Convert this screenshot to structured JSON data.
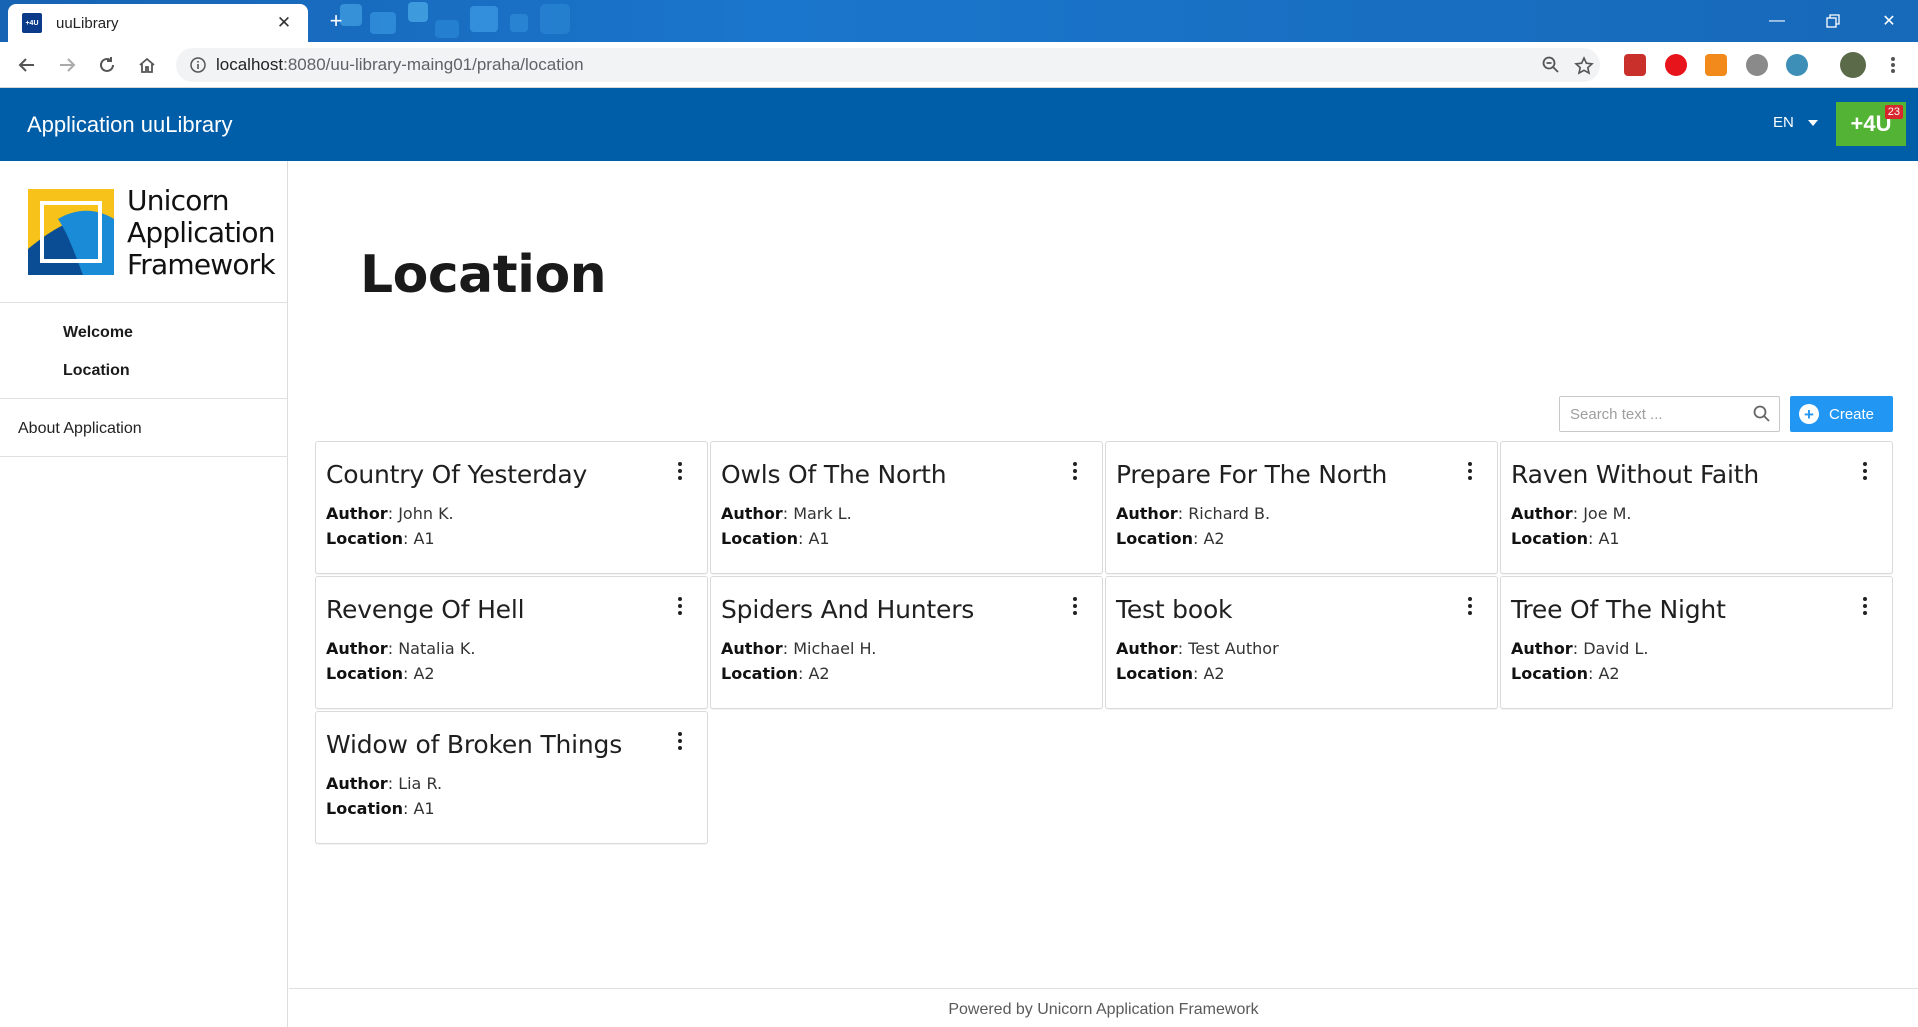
{
  "browser": {
    "tab_title": "uuLibrary",
    "tab_favicon_text": "+4U",
    "url_host": "localhost",
    "url_rest": ":8080/uu-library-maing01/praha/location"
  },
  "header": {
    "app_title": "Application uuLibrary",
    "language": "EN",
    "plus4u_label": "+4U",
    "notification_count": "23"
  },
  "sidebar": {
    "logo_lines": [
      "Unicorn",
      "Application",
      "Framework"
    ],
    "items": [
      {
        "label": "Welcome"
      },
      {
        "label": "Location"
      }
    ],
    "about": "About Application"
  },
  "main": {
    "title": "Location",
    "search_placeholder": "Search text ...",
    "create_label": "Create",
    "author_label": "Author",
    "location_label": "Location",
    "books": [
      {
        "title": "Country Of Yesterday",
        "author": "John K.",
        "location": "A1"
      },
      {
        "title": "Owls Of The North",
        "author": "Mark L.",
        "location": "A1"
      },
      {
        "title": "Prepare For The North",
        "author": "Richard B.",
        "location": "A2"
      },
      {
        "title": "Raven Without Faith",
        "author": "Joe M.",
        "location": "A1"
      },
      {
        "title": "Revenge Of Hell",
        "author": "Natalia K.",
        "location": "A2"
      },
      {
        "title": "Spiders And Hunters",
        "author": "Michael H.",
        "location": "A2"
      },
      {
        "title": "Test book",
        "author": "Test Author",
        "location": "A2"
      },
      {
        "title": "Tree Of The Night",
        "author": "David L.",
        "location": "A2"
      },
      {
        "title": "Widow of Broken Things",
        "author": "Lia R.",
        "location": "A1"
      }
    ]
  },
  "footer": "Powered by Unicorn Application Framework",
  "colors": {
    "header_bg": "#005da7",
    "plus4u_green": "#52b334",
    "create_blue": "#2196f3",
    "badge_red": "#d8262d"
  }
}
